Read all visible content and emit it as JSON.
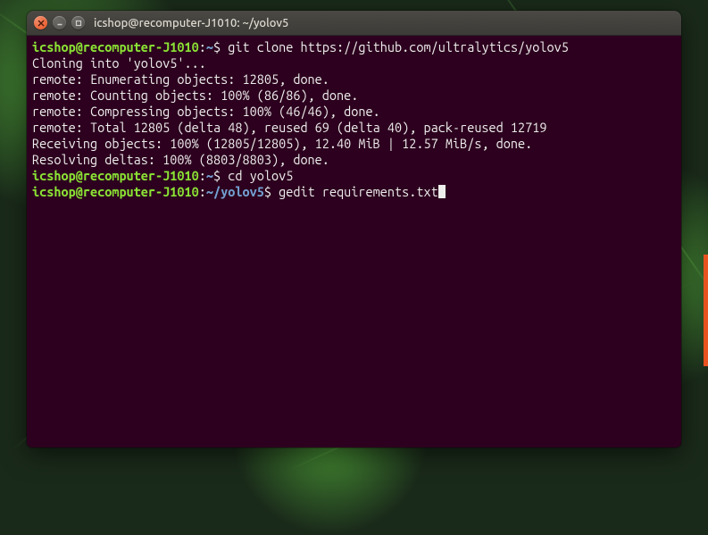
{
  "window": {
    "title": "icshop@recomputer-J1010: ~/yolov5"
  },
  "prompt": {
    "user_host": "icshop@recomputer-J1010",
    "home_path": "~",
    "cwd_path": "~/yolov5",
    "symbol": "$"
  },
  "lines": {
    "cmd1": " git clone https://github.com/ultralytics/yolov5",
    "out1": "Cloning into 'yolov5'...",
    "out2": "remote: Enumerating objects: 12805, done.",
    "out3": "remote: Counting objects: 100% (86/86), done.",
    "out4": "remote: Compressing objects: 100% (46/46), done.",
    "out5": "remote: Total 12805 (delta 48), reused 69 (delta 40), pack-reused 12719",
    "out6": "Receiving objects: 100% (12805/12805), 12.40 MiB | 12.57 MiB/s, done.",
    "out7": "Resolving deltas: 100% (8803/8803), done.",
    "cmd2": " cd yolov5",
    "cmd3": " gedit requirements.txt"
  }
}
